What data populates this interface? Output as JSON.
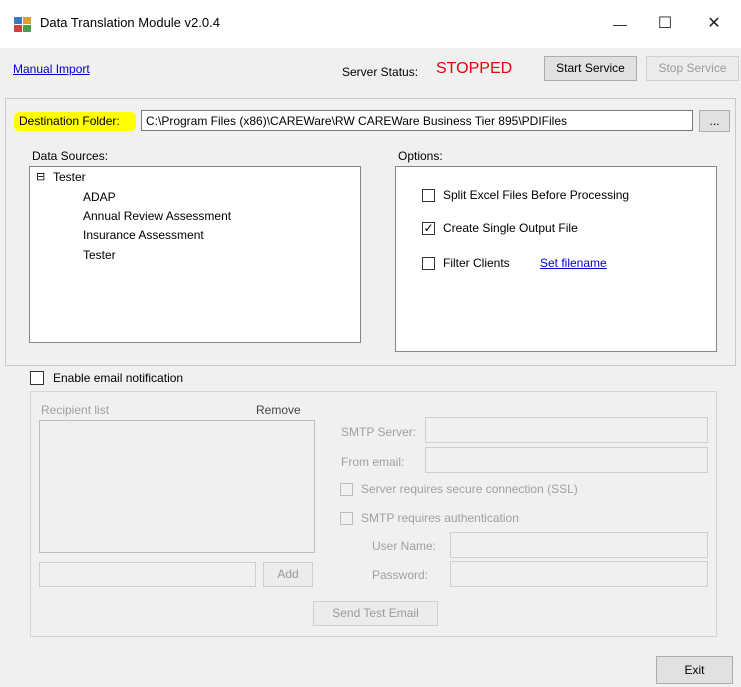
{
  "window": {
    "title": "Data Translation Module  v2.0.4",
    "minimize_glyph": "—",
    "maximize_glyph": "☐",
    "close_glyph": "✕",
    "icon": "app-module-icon"
  },
  "top": {
    "manual_import": "Manual Import",
    "server_status_label": "Server Status:",
    "server_status_value": "STOPPED",
    "status_color": "#e8000b",
    "start_service": "Start Service",
    "stop_service": "Stop Service"
  },
  "destination": {
    "label": "Destination Folder:",
    "value": "C:\\Program Files (x86)\\CAREWare\\RW CAREWare Business Tier 895\\PDIFiles",
    "browse": "...",
    "highlight_color": "#ffff00"
  },
  "data_sources": {
    "label": "Data Sources:",
    "root_toggle": "⊟",
    "root": "Tester",
    "children": [
      "ADAP",
      "Annual Review Assessment",
      "Insurance Assessment",
      "Tester"
    ]
  },
  "options": {
    "label": "Options:",
    "split_excel": {
      "label": "Split Excel Files Before Processing",
      "checked": false
    },
    "single_output": {
      "label": "Create Single Output File",
      "checked": true,
      "check_glyph": "✓"
    },
    "filter_clients": {
      "label": "Filter Clients",
      "checked": false
    },
    "set_filename": "Set filename"
  },
  "email": {
    "enable_label": "Enable email notification",
    "recipient_list": "Recipient list",
    "remove": "Remove",
    "add": "Add",
    "smtp_server": "SMTP Server:",
    "from_email": "From email:",
    "ssl": "Server requires secure connection (SSL)",
    "smtp_auth": "SMTP requires authentication",
    "user_name": "User Name:",
    "password": "Password:",
    "send_test": "Send Test Email"
  },
  "footer": {
    "exit": "Exit"
  }
}
